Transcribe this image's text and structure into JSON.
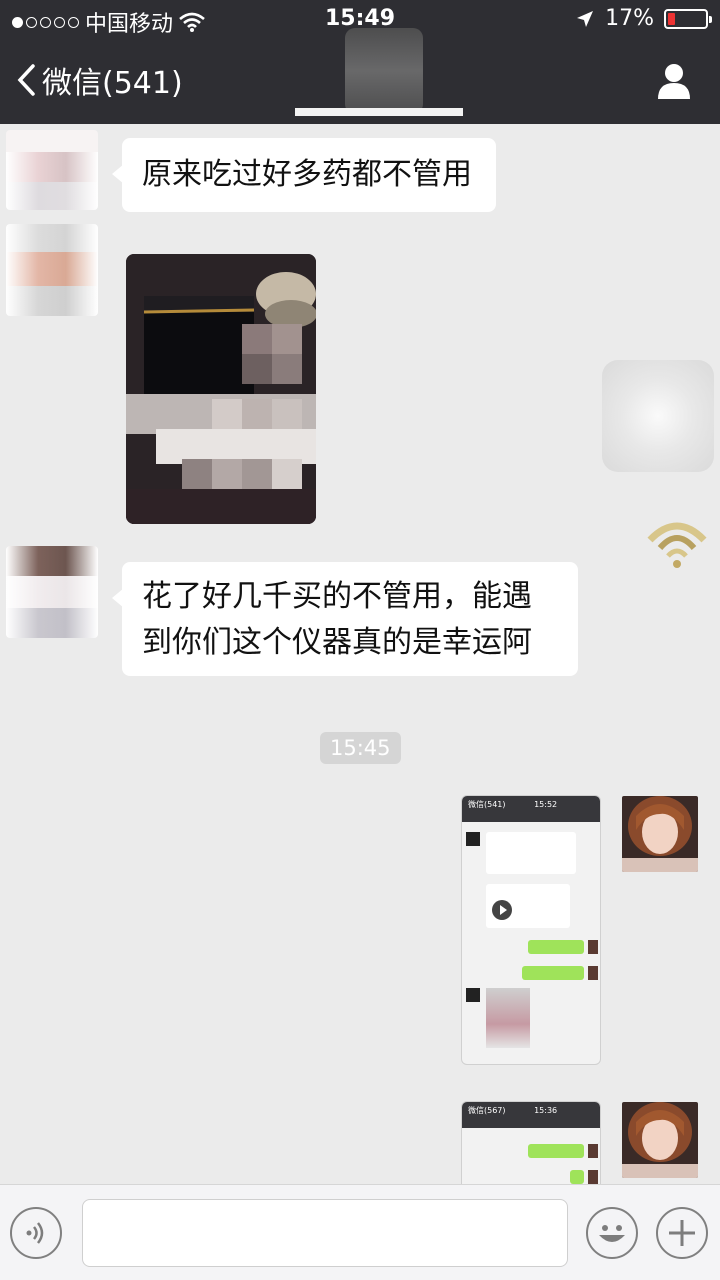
{
  "status_bar": {
    "carrier": "中国移动",
    "time": "15:49",
    "battery_percent": "17%",
    "battery_level": 0.17,
    "signal_bars_filled": 1,
    "signal_bars_total": 5
  },
  "nav": {
    "back_label": "微信(541)",
    "back_icon": "chevron-left-icon",
    "profile_icon": "person-icon"
  },
  "messages": [
    {
      "side": "left",
      "type": "text",
      "text": "原来吃过好多药都不管用"
    },
    {
      "side": "left",
      "type": "image"
    },
    {
      "side": "left",
      "type": "text",
      "line1": "花了好几千买的不管用，能遇",
      "line2": "到你们这个仪器真的是幸运阿"
    },
    {
      "type": "time",
      "text": "15:45"
    },
    {
      "side": "right",
      "type": "image",
      "mini_back": "微信(541)",
      "mini_time": "15:52"
    },
    {
      "side": "right",
      "type": "image",
      "mini_back": "微信(567)",
      "mini_time": "15:36"
    }
  ],
  "input_bar": {
    "voice_icon": "voice-icon",
    "emoji_icon": "smiley-icon",
    "plus_icon": "plus-icon"
  },
  "colors": {
    "header_bg": "#2e2e33",
    "chat_bg": "#ebebeb",
    "bubble_left": "#ffffff",
    "bubble_right": "#9fe35a"
  }
}
